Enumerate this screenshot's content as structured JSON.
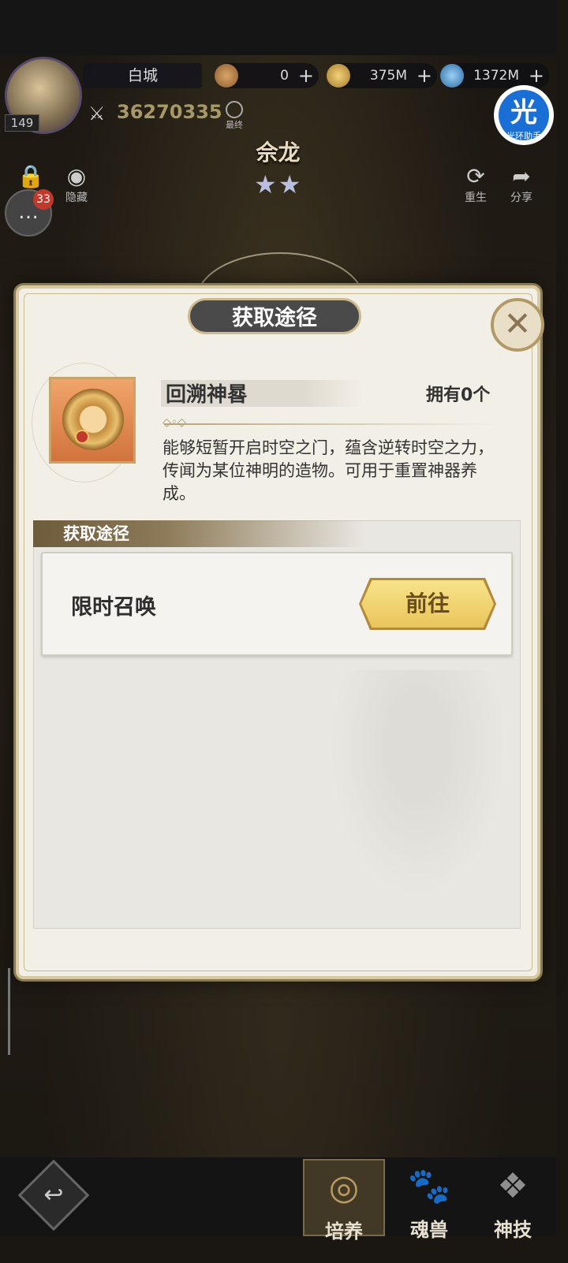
{
  "player": {
    "name": "白城",
    "level": "149",
    "power": "36270335",
    "final_label": "最终"
  },
  "resources": [
    {
      "icon": "bronze-coin-icon",
      "value": "0"
    },
    {
      "icon": "gold-coin-icon",
      "value": "375M"
    },
    {
      "icon": "potion-icon",
      "value": "1372M"
    }
  ],
  "hero": {
    "name": "佘龙",
    "stars": "★★"
  },
  "helper": {
    "glyph": "光",
    "label": "光环助手"
  },
  "side_icons": {
    "hide": "隐藏",
    "chat_count": "33",
    "rebirth": "重生",
    "share": "分享"
  },
  "popup": {
    "title": "获取途径",
    "close_glyph": "✕",
    "item": {
      "name": "回溯神晷",
      "owned": "拥有0个",
      "description": "能够短暂开启时空之门，蕴含逆转时空之力，传闻为某位神明的造物。可用于重置神器养成。"
    },
    "section_title": "获取途径",
    "routes": [
      {
        "label": "限时召唤",
        "button": "前往"
      }
    ]
  },
  "bottom_nav": {
    "back_glyph": "↩",
    "tabs": [
      {
        "label": "培养",
        "icon": "eye-emblem-icon",
        "active": true
      },
      {
        "label": "魂兽",
        "icon": "paw-icon",
        "active": false
      },
      {
        "label": "神技",
        "icon": "wing-emblem-icon",
        "active": false
      }
    ]
  }
}
